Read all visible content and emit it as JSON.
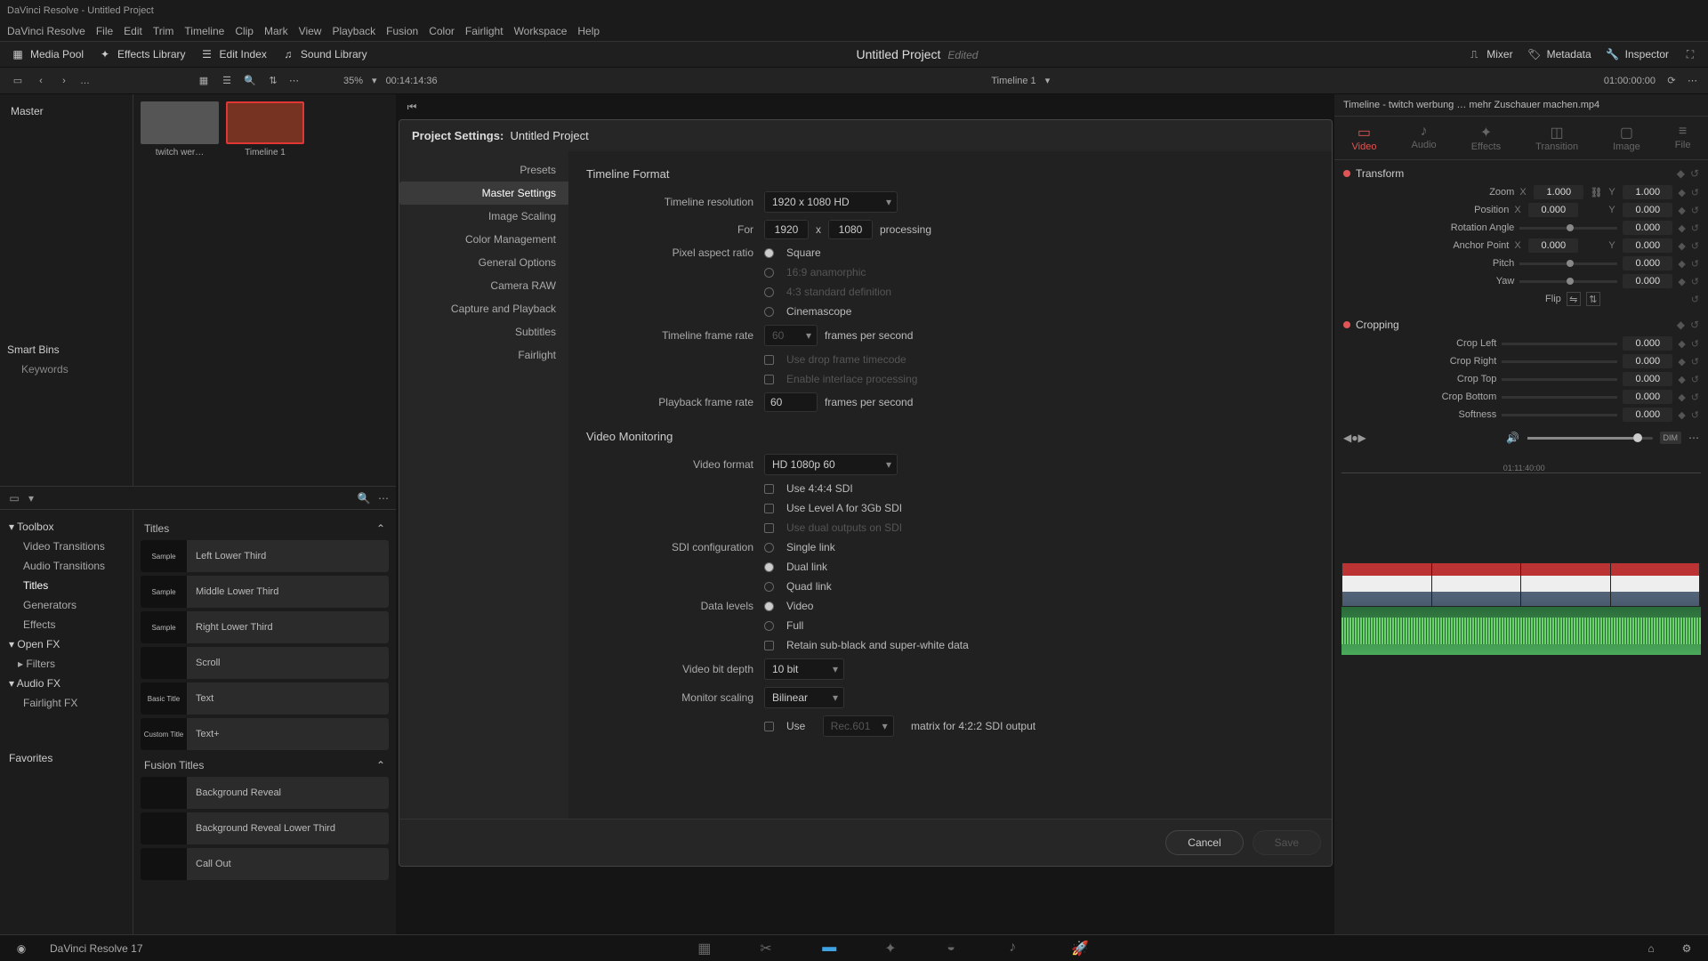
{
  "titlebar": "DaVinci Resolve - Untitled Project",
  "menubar": [
    "DaVinci Resolve",
    "File",
    "Edit",
    "Trim",
    "Timeline",
    "Clip",
    "Mark",
    "View",
    "Playback",
    "Fusion",
    "Color",
    "Fairlight",
    "Workspace",
    "Help"
  ],
  "toolbar": {
    "media_pool": "Media Pool",
    "effects_library": "Effects Library",
    "edit_index": "Edit Index",
    "sound_library": "Sound Library",
    "mixer": "Mixer",
    "metadata": "Metadata",
    "inspector": "Inspector",
    "project_title": "Untitled Project",
    "edited": "Edited"
  },
  "subtoolbar": {
    "zoom_pct": "35%",
    "timecode_left": "00:14:14:36",
    "timeline_name": "Timeline 1",
    "timecode_right": "01:00:00:00"
  },
  "media_pool": {
    "master": "Master",
    "smart_bins": "Smart Bins",
    "keywords": "Keywords",
    "clips": [
      {
        "name": "twitch wer…"
      },
      {
        "name": "Timeline 1"
      }
    ]
  },
  "effects": {
    "categories": [
      {
        "label": "Toolbox",
        "header": true
      },
      {
        "label": "Video Transitions"
      },
      {
        "label": "Audio Transitions"
      },
      {
        "label": "Titles",
        "active": true
      },
      {
        "label": "Generators"
      },
      {
        "label": "Effects"
      },
      {
        "label": "Open FX",
        "header": true
      },
      {
        "label": "Filters"
      },
      {
        "label": "Audio FX",
        "header": true
      },
      {
        "label": "Fairlight FX"
      }
    ],
    "favorites": "Favorites",
    "titles_header": "Titles",
    "titles": [
      "Left Lower Third",
      "Middle Lower Third",
      "Right Lower Third",
      "Scroll",
      "Text",
      "Text+"
    ],
    "title_thumbs": [
      "Sample",
      "Sample",
      "Sample",
      "",
      "Basic Title",
      "Custom Title"
    ],
    "fusion_header": "Fusion Titles",
    "fusion_titles": [
      "Background Reveal",
      "Background Reveal Lower Third",
      "Call Out"
    ]
  },
  "inspector": {
    "header": "Timeline - twitch werbung … mehr Zuschauer machen.mp4",
    "tabs": [
      "Video",
      "Audio",
      "Effects",
      "Transition",
      "Image",
      "File"
    ],
    "transform": {
      "title": "Transform",
      "zoom_x": "1.000",
      "zoom_y": "1.000",
      "pos_x": "0.000",
      "pos_y": "0.000",
      "rot": "0.000",
      "anchor_x": "0.000",
      "anchor_y": "0.000",
      "pitch": "0.000",
      "yaw": "0.000",
      "flip": "Flip",
      "labels": {
        "zoom": "Zoom",
        "position": "Position",
        "rotation": "Rotation Angle",
        "anchor": "Anchor Point",
        "pitch": "Pitch",
        "yaw": "Yaw"
      }
    },
    "cropping": {
      "title": "Cropping",
      "left": "0.000",
      "right": "0.000",
      "top": "0.000",
      "bottom": "0.000",
      "softness": "0.000",
      "labels": {
        "left": "Crop Left",
        "right": "Crop Right",
        "top": "Crop Top",
        "bottom": "Crop Bottom",
        "softness": "Softness"
      }
    },
    "tl_time": "01:11:40:00",
    "dim": "DIM"
  },
  "modal": {
    "title_prefix": "Project Settings:",
    "title_name": "Untitled Project",
    "side": [
      "Presets",
      "Master Settings",
      "Image Scaling",
      "Color Management",
      "General Options",
      "Camera RAW",
      "Capture and Playback",
      "Subtitles",
      "Fairlight"
    ],
    "side_active": 1,
    "tf": {
      "heading": "Timeline Format",
      "resolution_label": "Timeline resolution",
      "resolution_value": "1920 x 1080 HD",
      "for": "For",
      "w": "1920",
      "x": "x",
      "h": "1080",
      "processing": "processing",
      "par_label": "Pixel aspect ratio",
      "par_opts": [
        "Square",
        "16:9 anamorphic",
        "4:3 standard definition",
        "Cinemascope"
      ],
      "tfr_label": "Timeline frame rate",
      "tfr_val": "60",
      "fps": "frames per second",
      "drop": "Use drop frame timecode",
      "interlace": "Enable interlace processing",
      "pfr_label": "Playback frame rate",
      "pfr_val": "60"
    },
    "vm": {
      "heading": "Video Monitoring",
      "vf_label": "Video format",
      "vf_val": "HD 1080p 60",
      "sdi444": "Use 4:4:4 SDI",
      "levelA": "Use Level A for 3Gb SDI",
      "dual_out": "Use dual outputs on SDI",
      "sdi_label": "SDI configuration",
      "sdi_opts": [
        "Single link",
        "Dual link",
        "Quad link"
      ],
      "dl_label": "Data levels",
      "dl_opts": [
        "Video",
        "Full"
      ],
      "retain": "Retain sub-black and super-white data",
      "vbd_label": "Video bit depth",
      "vbd_val": "10 bit",
      "ms_label": "Monitor scaling",
      "ms_val": "Bilinear",
      "use": "Use",
      "rec": "Rec.601",
      "matrix": "matrix for 4:2:2 SDI output"
    },
    "cancel": "Cancel",
    "save": "Save"
  },
  "bottom": {
    "app": "DaVinci Resolve 17"
  }
}
